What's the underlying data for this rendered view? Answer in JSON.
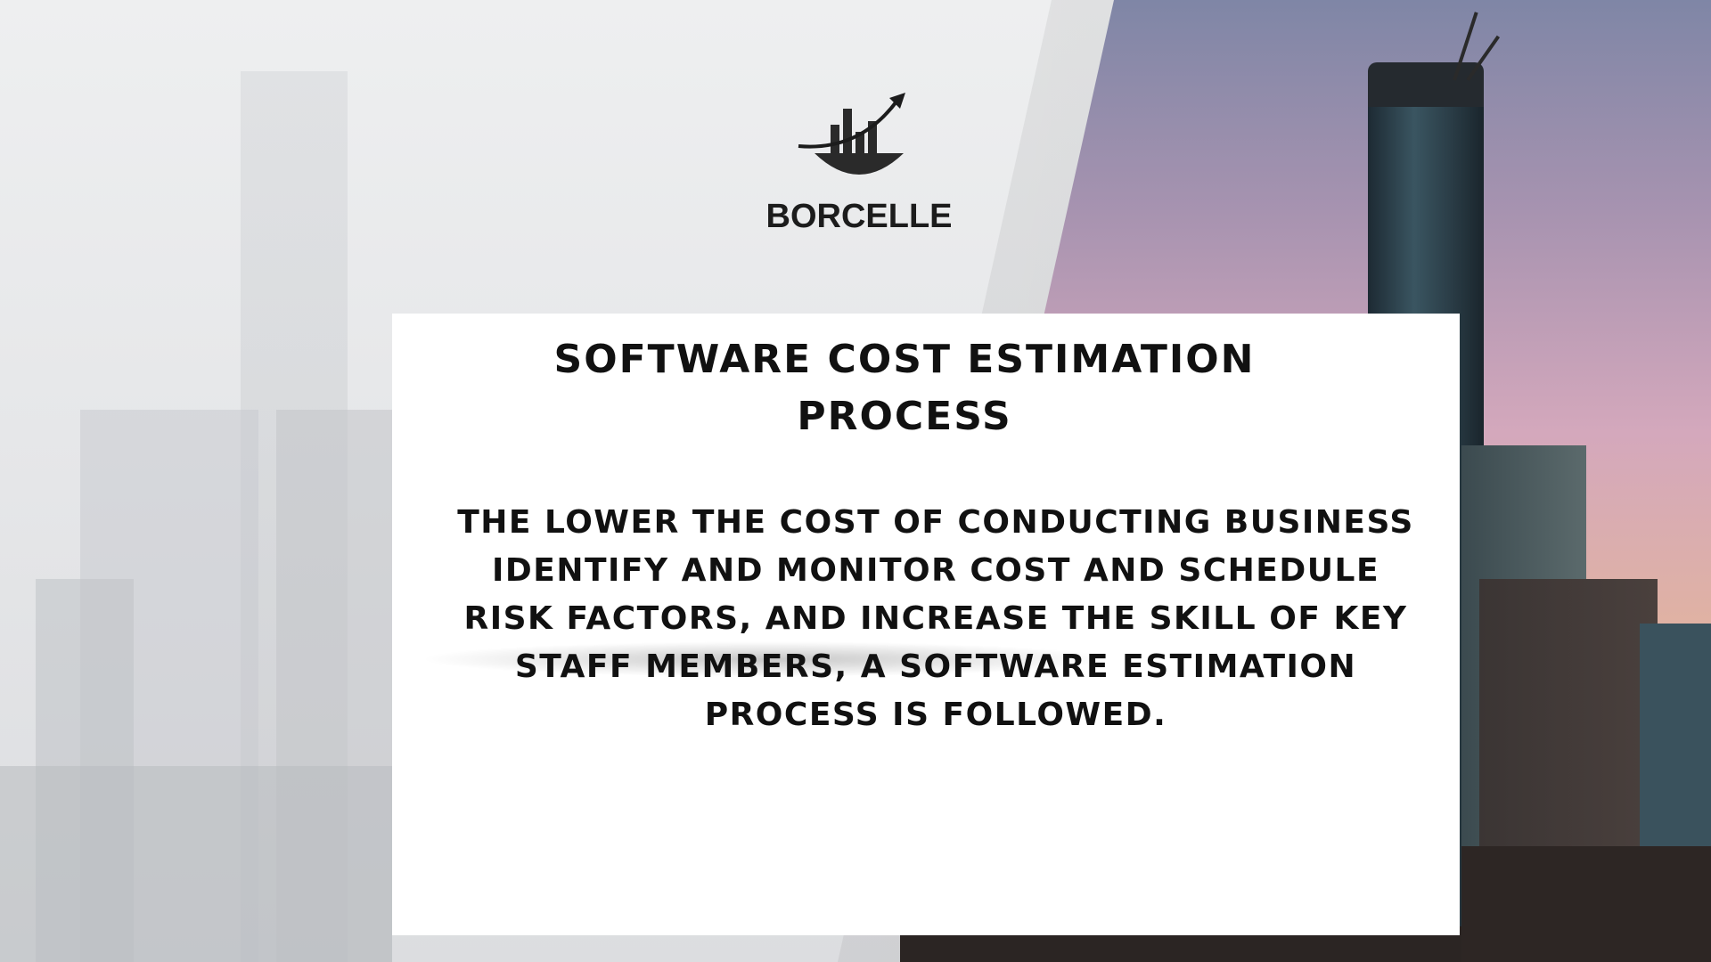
{
  "brand": {
    "name": "BORCELLE",
    "logo_icon": "rising-bar-chart-icon"
  },
  "slide": {
    "title": "SOFTWARE COST ESTIMATION PROCESS",
    "body": "THE LOWER THE COST OF CONDUCTING BUSINESS IDENTIFY AND MONITOR COST AND SCHEDULE RISK FACTORS, AND INCREASE THE SKILL OF KEY STAFF MEMBERS, A SOFTWARE ESTIMATION PROCESS IS FOLLOWED."
  },
  "colors": {
    "text": "#111111",
    "panel": "#ffffff"
  }
}
